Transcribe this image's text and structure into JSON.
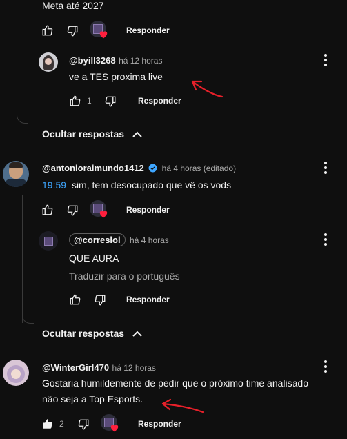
{
  "top": {
    "text": "Meta até 2027",
    "reply_label": "Responder"
  },
  "reply1": {
    "handle": "@byill3268",
    "time": "há 12 horas",
    "text": "ve a TES proxima live",
    "likes": "1",
    "reply_label": "Responder"
  },
  "hide1": {
    "label": "Ocultar respostas"
  },
  "comment2": {
    "handle": "@antonioraimundo1412",
    "time": "há 4 horas (editado)",
    "timestamp": "19:59",
    "text": "sim, tem desocupado que vê os vods",
    "reply_label": "Responder"
  },
  "reply2": {
    "handle": "@correslol",
    "time": "há 4 horas",
    "text": "QUE AURA",
    "translate": "Traduzir para o português",
    "reply_label": "Responder"
  },
  "hide2": {
    "label": "Ocultar respostas"
  },
  "comment3": {
    "handle": "@WinterGirl470",
    "time": "há 12 horas",
    "text_line1": "Gostaria humildemente de pedir que o próximo time analisado",
    "text_line2": "não seja a Top Esports.",
    "likes": "2",
    "reply_label": "Responder"
  },
  "colors": {
    "annotation": "#e8202a",
    "link": "#3ea6ff",
    "heart": "#ff1f3d"
  }
}
